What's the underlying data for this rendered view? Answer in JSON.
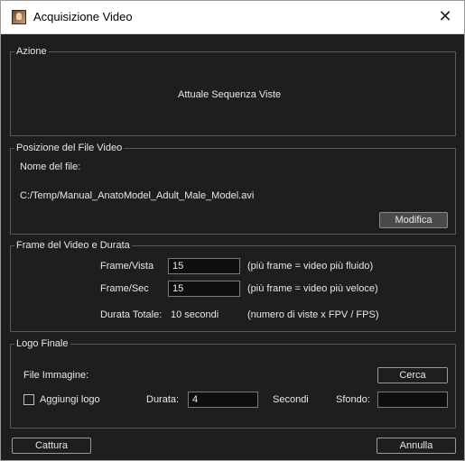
{
  "window": {
    "title": "Acquisizione Video",
    "close_glyph": "✕"
  },
  "azione": {
    "legend": "Azione",
    "text": "Attuale Sequenza Viste"
  },
  "posizione": {
    "legend": "Posizione del File Video",
    "filename_label": "Nome del file:",
    "path": "C:/Temp/Manual_AnatoModel_Adult_Male_Model.avi",
    "modify_button": "Modifica"
  },
  "frame": {
    "legend": "Frame del Video e Durata",
    "frame_vista_label": "Frame/Vista",
    "frame_vista_value": "15",
    "frame_vista_hint": "(più frame = video più fluido)",
    "frame_sec_label": "Frame/Sec",
    "frame_sec_value": "15",
    "frame_sec_hint": "(più frame = video più veloce)",
    "durata_label": "Durata Totale:",
    "durata_value": "10 secondi",
    "durata_hint": "(numero di viste x FPV / FPS)"
  },
  "logo": {
    "legend": "Logo Finale",
    "file_label": "File Immagine:",
    "cerca_button": "Cerca",
    "aggiungi_label": "Aggiungi logo",
    "aggiungi_checked": false,
    "durata_label": "Durata:",
    "durata_value": "4",
    "secondi_label": "Secondi",
    "sfondo_label": "Sfondo:",
    "sfondo_value": ""
  },
  "footer": {
    "cattura_button": "Cattura",
    "annulla_button": "Annulla"
  }
}
